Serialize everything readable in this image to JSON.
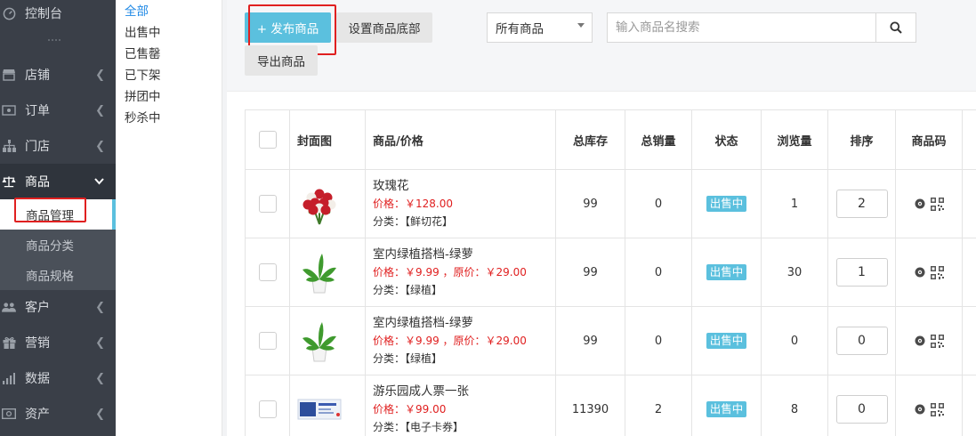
{
  "sidebar": {
    "items": [
      {
        "label": "控制台",
        "icon": "dashboard-icon",
        "has_arrow": false
      },
      {
        "label": "店铺",
        "icon": "store-icon",
        "has_arrow": true
      },
      {
        "label": "订单",
        "icon": "order-icon",
        "has_arrow": true
      },
      {
        "label": "门店",
        "icon": "branch-icon",
        "has_arrow": true
      },
      {
        "label": "商品",
        "icon": "scale-icon",
        "has_arrow": true,
        "expanded": true
      },
      {
        "label": "客户",
        "icon": "users-icon",
        "has_arrow": true
      },
      {
        "label": "营销",
        "icon": "gift-icon",
        "has_arrow": true
      },
      {
        "label": "数据",
        "icon": "bar-chart-icon",
        "has_arrow": true
      },
      {
        "label": "资产",
        "icon": "money-icon",
        "has_arrow": true
      }
    ],
    "goods_sub": [
      "商品管理",
      "商品分类",
      "商品规格"
    ],
    "active_sub": "商品管理"
  },
  "filter_tabs": [
    "全部",
    "出售中",
    "已售罄",
    "已下架",
    "拼团中",
    "秒杀中"
  ],
  "active_filter": "全部",
  "toolbar": {
    "publish_label": "+ 发布商品",
    "footer_label": "设置商品底部",
    "export_label": "导出商品",
    "select_value": "所有商品",
    "search_placeholder": "输入商品名搜索"
  },
  "table": {
    "headers": [
      "封面图",
      "商品/价格",
      "总库存",
      "总销量",
      "状态",
      "浏览量",
      "排序",
      "商品码"
    ],
    "rows": [
      {
        "name": "玫瑰花",
        "price_line": "价格：￥128.00",
        "category": "分类：【鲜切花】",
        "stock": "99",
        "sales": "0",
        "status": "出售中",
        "views": "1",
        "sort": "2",
        "image": "roses"
      },
      {
        "name": "室内绿植搭档-绿萝",
        "price_line": "价格：￥9.99 ，原价：￥29.00",
        "category": "分类：【绿植】",
        "stock": "99",
        "sales": "0",
        "status": "出售中",
        "views": "30",
        "sort": "1",
        "image": "plant"
      },
      {
        "name": "室内绿植搭档-绿萝",
        "price_line": "价格：￥9.99 ，原价：￥29.00",
        "category": "分类：【绿植】",
        "stock": "99",
        "sales": "0",
        "status": "出售中",
        "views": "0",
        "sort": "0",
        "image": "plant"
      },
      {
        "name": "游乐园成人票一张",
        "price_line": "价格：￥99.00",
        "category": "分类：【电子卡券】",
        "stock": "11390",
        "sales": "2",
        "status": "出售中",
        "views": "8",
        "sort": "0",
        "image": "ticket"
      }
    ]
  },
  "colors": {
    "accent": "#5bc0de",
    "sidebar_bg": "#3a3f48",
    "price_red": "#e02020",
    "highlight_red": "#e02020"
  }
}
